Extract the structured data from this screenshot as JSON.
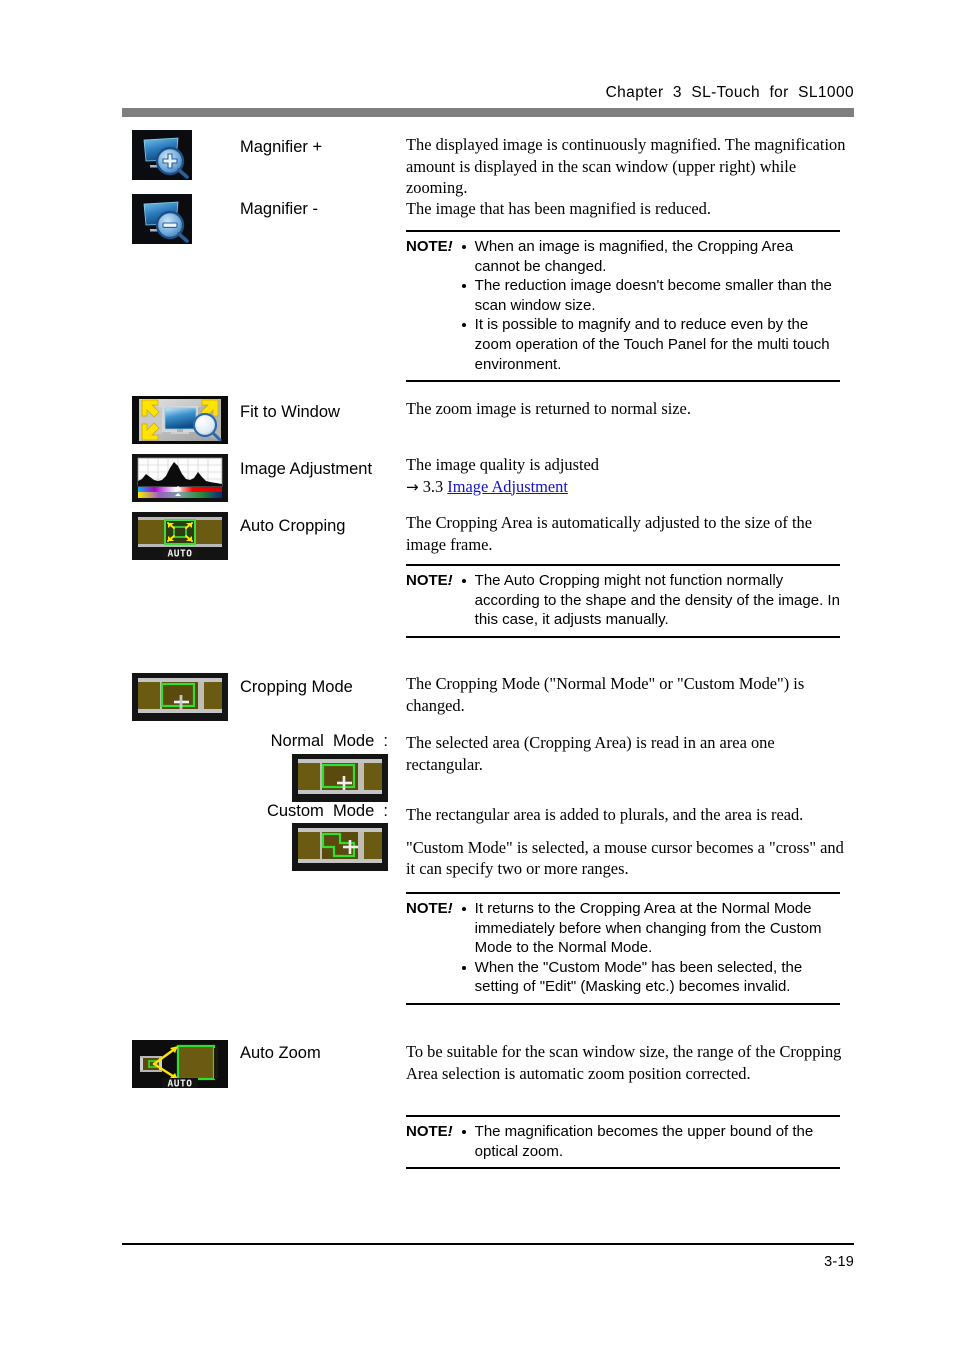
{
  "header": {
    "title": "Chapter  3  SL-Touch  for  SL1000"
  },
  "footer": {
    "page_number": "3-19"
  },
  "note_tag": {
    "text": "NOTE",
    "mark": "!"
  },
  "rows": [
    {
      "id": "magnifier-plus",
      "icon_name": "magnifier-plus-icon",
      "label": "Magnifier +",
      "description": "The displayed image is continuously magnified. The magnification amount is displayed in the scan window (upper right) while zooming."
    },
    {
      "id": "magnifier-minus",
      "icon_name": "magnifier-minus-icon",
      "label": "Magnifier -",
      "description": "The image that has been magnified is reduced."
    },
    {
      "id": "fit-to-window",
      "icon_name": "fit-to-window-icon",
      "label": "Fit to Window",
      "description": "The zoom image is returned to normal size."
    },
    {
      "id": "image-adjustment",
      "icon_name": "image-adjustment-icon",
      "label": "Image Adjustment",
      "description": "The image quality is adjusted",
      "cross_ref_arrow": "→",
      "cross_ref_number": "3.3",
      "cross_ref_link": "Image Adjustment"
    },
    {
      "id": "auto-cropping",
      "icon_name": "auto-cropping-icon",
      "label": "Auto Cropping",
      "description": "The Cropping Area is automatically adjusted to the size of the image frame."
    },
    {
      "id": "cropping-mode",
      "icon_name": "cropping-mode-icon",
      "label": "Cropping Mode",
      "description": "The Cropping Mode (\"Normal Mode\" or \"Custom Mode\") is changed."
    },
    {
      "id": "auto-zoom",
      "icon_name": "auto-zoom-icon",
      "label": "Auto Zoom",
      "description": "To be suitable for the scan window size, the range of the Cropping Area selection is automatic zoom position corrected."
    }
  ],
  "submodes": [
    {
      "id": "normal-mode",
      "label": "Normal  Mode  :",
      "icon_name": "normal-mode-icon",
      "description": "The selected area (Cropping Area) is read in an area one rectangular."
    },
    {
      "id": "custom-mode",
      "label": "Custom  Mode  :",
      "icon_name": "custom-mode-icon",
      "description_1": "The rectangular area is added to plurals, and the area is read.",
      "description_2": "\"Custom Mode\" is selected, a mouse cursor becomes a \"cross\" and it can specify two or more ranges."
    }
  ],
  "notes": [
    {
      "id": "note-magnifier",
      "items": [
        "When an image is magnified, the Cropping Area cannot be changed.",
        "The reduction image doesn't become smaller than the scan window size.",
        "It is possible to magnify and to reduce even by the zoom operation of the Touch Panel for the multi touch environment."
      ]
    },
    {
      "id": "note-auto-cropping",
      "items": [
        "The Auto Cropping might not function normally according to the shape and the density of the image. In this case, it adjusts manually."
      ]
    },
    {
      "id": "note-cropping-mode",
      "items": [
        "It returns to the Cropping Area at the Normal Mode immediately before when changing from the Custom Mode to the Normal Mode.",
        "When the \"Custom Mode\" has been selected, the setting of \"Edit\" (Masking etc.) becomes invalid."
      ]
    },
    {
      "id": "note-auto-zoom",
      "items": [
        "The magnification becomes the upper bound of the optical zoom."
      ]
    }
  ],
  "icon_labels": {
    "auto_badge": "AUTO"
  },
  "colors": {
    "header_bar": "#7f7f7f",
    "link": "#1111cc",
    "icon_green": "#33dd33",
    "icon_yellow": "#ffe300",
    "icon_blue": "#2e7fd0",
    "icon_olive": "#6b5b10"
  }
}
